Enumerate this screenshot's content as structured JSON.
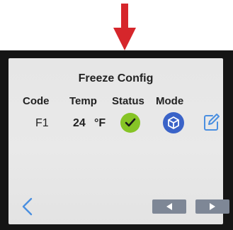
{
  "screen": {
    "title": "Freeze Config"
  },
  "table": {
    "headers": {
      "code": "Code",
      "temp": "Temp",
      "status": "Status",
      "mode": "Mode"
    },
    "row": {
      "code": "F1",
      "temp_value": "24",
      "temp_unit": "°F",
      "status_icon": "checkmark-icon",
      "mode_icon": "cube-icon",
      "edit_icon": "edit-icon"
    }
  },
  "nav": {
    "back_icon": "back-chevron-icon",
    "prev_icon": "prev-arrow-icon",
    "next_icon": "next-arrow-icon"
  },
  "colors": {
    "pointer_arrow": "#d6262b",
    "status_ok": "#86c426",
    "mode_blue": "#3a63c8",
    "accent_blue": "#4a8fe0",
    "nav_button": "#7e8796",
    "screen_bg": "#e6e6e6",
    "bezel": "#151515"
  }
}
